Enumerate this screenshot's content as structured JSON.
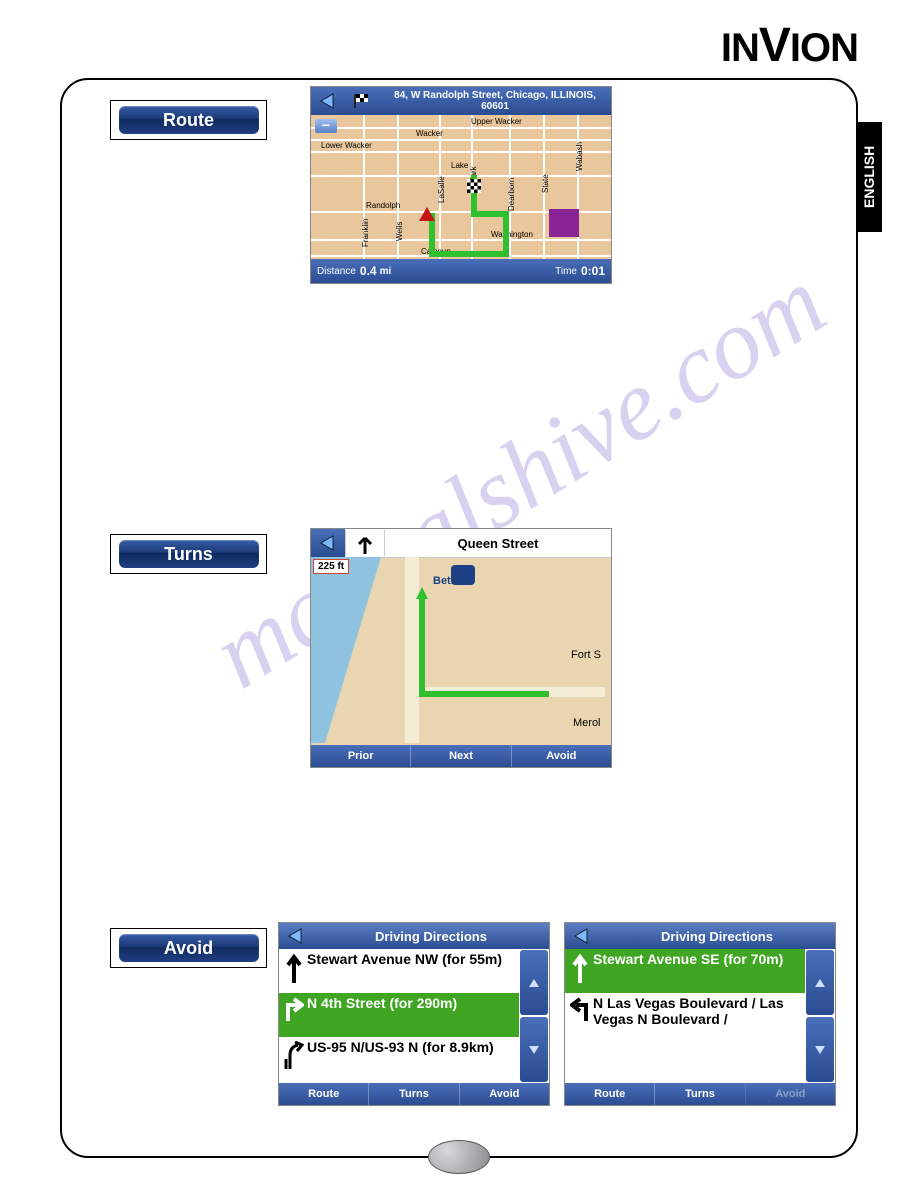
{
  "brand": "INVION",
  "language_tab": "ENGLISH",
  "buttons": {
    "route": "Route",
    "turns": "Turns",
    "avoid": "Avoid"
  },
  "route_shot": {
    "address": "84, W Randolph Street, Chicago, ILLINOIS, 60601",
    "distance_label": "Distance",
    "distance_value": "0.4",
    "distance_unit": "mi",
    "time_label": "Time",
    "time_value": "0:01",
    "streets": {
      "upper_wacker": "Upper Wacker",
      "wacker": "Wacker",
      "lower_wacker": "Lower Wacker",
      "lake": "Lake",
      "randolph": "Randolph",
      "washington": "Washington",
      "calhoun": "Calhoun",
      "franklin": "Franklin",
      "lasalle": "LaSalle",
      "clark": "Clark",
      "dearborn": "Dearborn",
      "state": "State",
      "wabash": "Wabash",
      "wells": "Wells"
    }
  },
  "turns_shot": {
    "title": "Queen Street",
    "distance_badge": "225 ft",
    "places": {
      "bethel": "Bethel",
      "fort": "Fort S",
      "merol": "Merol"
    },
    "buttons": {
      "prior": "Prior",
      "next": "Next",
      "avoid": "Avoid"
    }
  },
  "avoid_shots": {
    "title": "Driving Directions",
    "left_list": [
      {
        "text": "Stewart Avenue NW (for 55m)",
        "icon": "straight",
        "selected": false
      },
      {
        "text": "N 4th Street (for 290m)",
        "icon": "right",
        "selected": true
      },
      {
        "text": "US-95 N/US-93 N (for 8.9km)",
        "icon": "merge",
        "selected": false
      }
    ],
    "right_list": [
      {
        "text": "Stewart Avenue SE (for 70m)",
        "icon": "straight",
        "selected": true
      },
      {
        "text": "N Las Vegas Boulevard / Las Vegas N Boulevard /",
        "icon": "left",
        "selected": false
      }
    ],
    "bottom_buttons": {
      "route": "Route",
      "turns": "Turns",
      "avoid": "Avoid"
    }
  },
  "watermark": "manualshive.com"
}
